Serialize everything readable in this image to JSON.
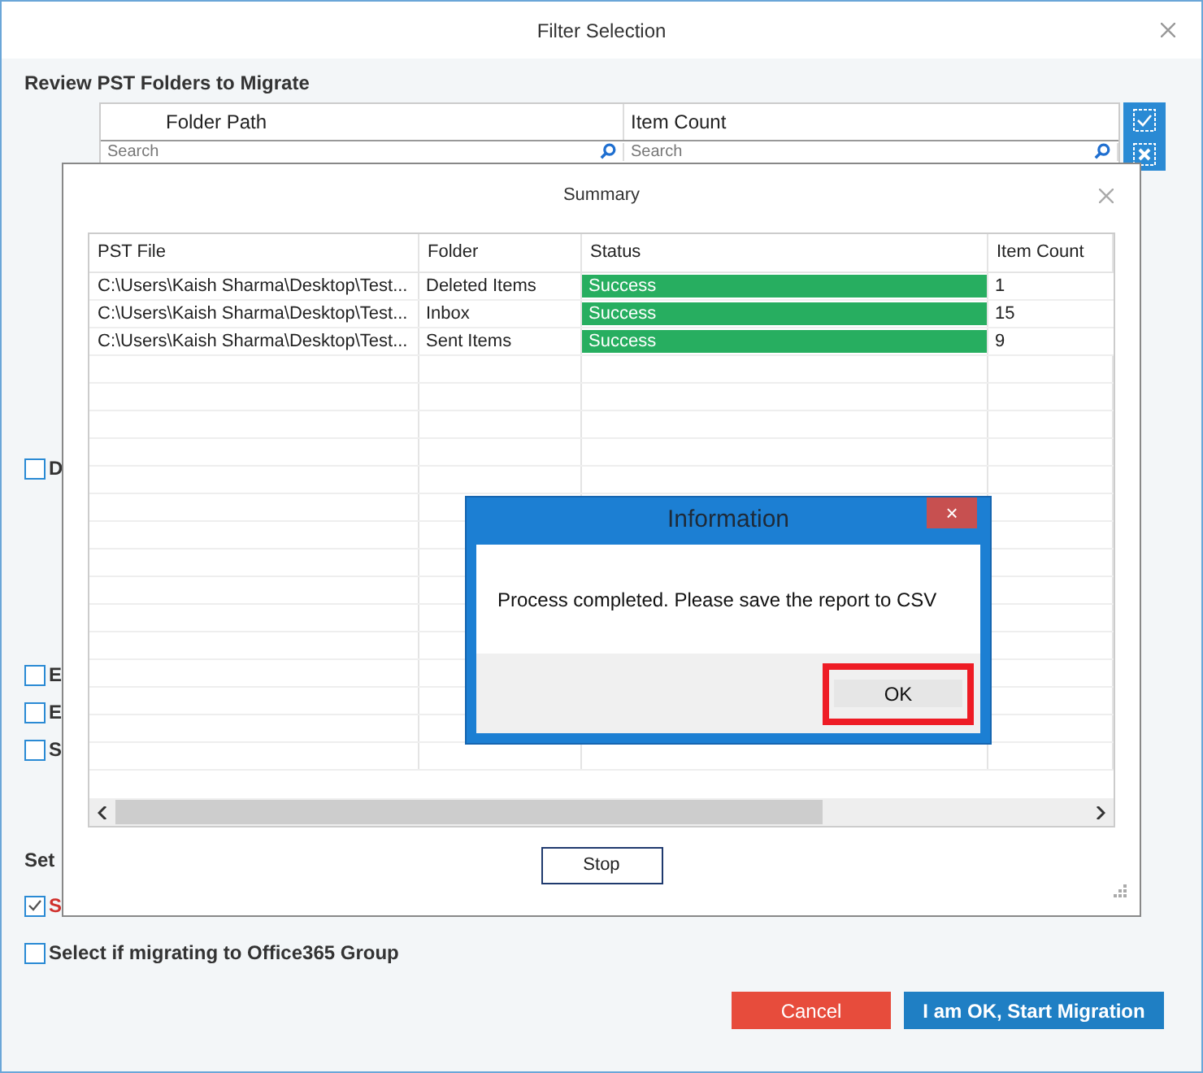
{
  "window": {
    "title": "Filter Selection"
  },
  "section_title": "Review PST Folders to Migrate",
  "folder_table": {
    "columns": [
      "Folder Path",
      "Item Count"
    ],
    "search_placeholders": [
      "Search",
      "Search"
    ]
  },
  "options_top": [
    {
      "label": "D",
      "checked": false
    }
  ],
  "options_middle": [
    {
      "label": "E",
      "checked": false
    },
    {
      "label": "E",
      "checked": false
    },
    {
      "label": "S",
      "checked": false
    }
  ],
  "set_label": "Set",
  "options_bottom": [
    {
      "label": "S",
      "checked": true,
      "highlighted": true
    }
  ],
  "group_option": {
    "label": "Select if migrating to Office365 Group",
    "checked": false
  },
  "buttons": [
    {
      "label": "Cancel",
      "kind": "danger"
    },
    {
      "label": "I am OK, Start Migration",
      "kind": "primary"
    }
  ],
  "summary": {
    "title": "Summary",
    "columns": [
      "PST File",
      "Folder",
      "Status",
      "Item Count"
    ],
    "rows": [
      {
        "pst_file": "C:\\Users\\Kaish Sharma\\Desktop\\Test...",
        "folder": "Deleted Items",
        "status": "Success",
        "kind": "success",
        "item_count": "1"
      },
      {
        "pst_file": "C:\\Users\\Kaish Sharma\\Desktop\\Test...",
        "folder": "Inbox",
        "status": "Success",
        "kind": "success",
        "item_count": "15"
      },
      {
        "pst_file": "C:\\Users\\Kaish Sharma\\Desktop\\Test...",
        "folder": "Sent Items",
        "status": "Success",
        "kind": "success",
        "item_count": "9"
      }
    ],
    "stop_button": "Stop"
  },
  "information": {
    "title": "Information",
    "close": "×",
    "message": "Process completed. Please save the report to CSV",
    "ok_button": "OK"
  }
}
